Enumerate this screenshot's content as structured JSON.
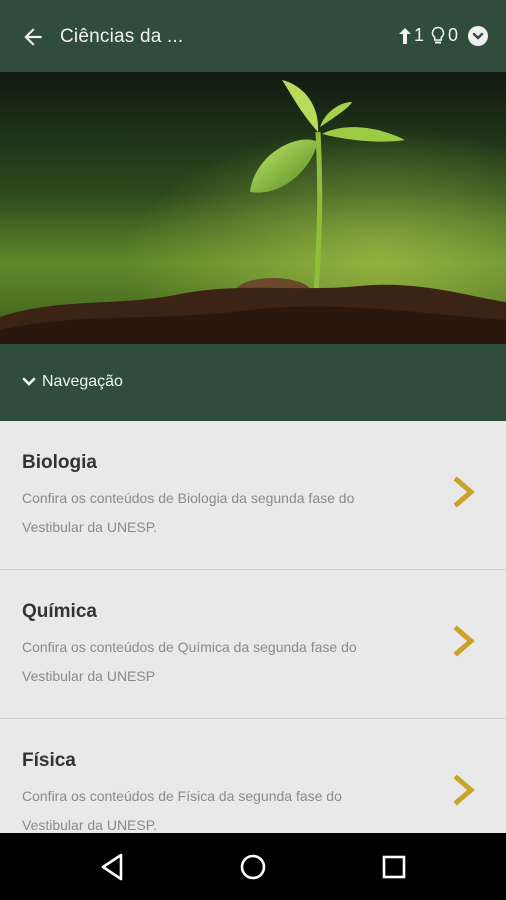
{
  "header": {
    "title": "Ciências da ...",
    "uploads_count": "1",
    "ideas_count": "0"
  },
  "navigation": {
    "label": "Navegação"
  },
  "items": [
    {
      "title": "Biologia",
      "description": "Confira os conteúdos de Biologia da segunda fase do Vestibular da UNESP."
    },
    {
      "title": "Química",
      "description": "Confira os conteúdos de Química da segunda fase do Vestibular da UNESP"
    },
    {
      "title": "Física",
      "description": "Confira os conteúdos de Física da segunda fase do Vestibular da UNESP."
    }
  ],
  "colors": {
    "bar_green": "#2f4d3a",
    "arrow_gold": "#c9a227",
    "background": "#e9e9e9"
  },
  "icons": [
    "back-arrow-icon",
    "upload-icon",
    "lightbulb-icon",
    "chevron-down-icon",
    "chevron-right-icon",
    "back-triangle-icon",
    "home-circle-icon",
    "recents-square-icon"
  ]
}
